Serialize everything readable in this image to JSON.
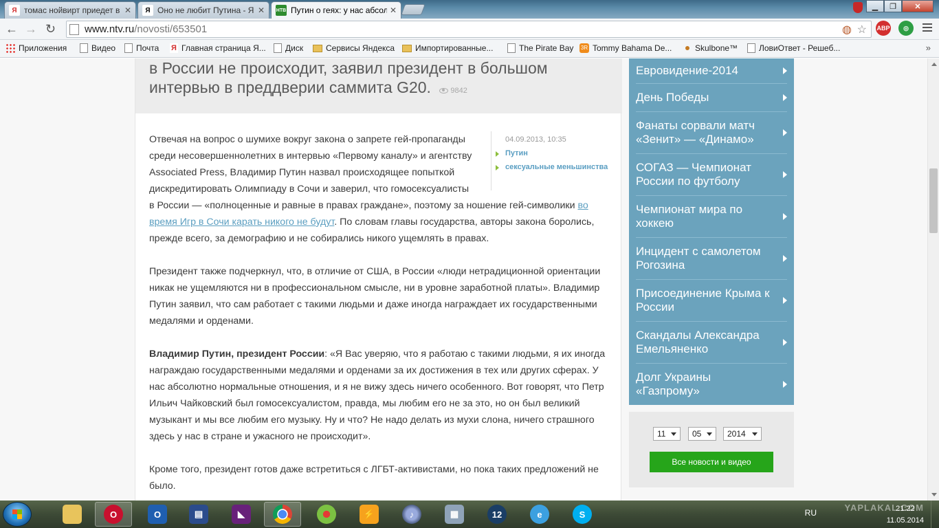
{
  "browser": {
    "tabs": [
      {
        "title": "томас нойвирт приедет в",
        "favicon": "ya"
      },
      {
        "title": "Оно не любит Путина - Я",
        "favicon": "ya-dark"
      },
      {
        "title": "Путин о геях: у нас абсолю",
        "favicon": "ntv",
        "active": true
      }
    ],
    "url_host": "www.ntv.ru",
    "url_path": "/novosti/653501",
    "bookmarks": [
      {
        "label": "Приложения",
        "icon": "apps-icon"
      },
      {
        "label": "Видео",
        "icon": "page-icon"
      },
      {
        "label": "Почта",
        "icon": "page-icon"
      },
      {
        "label": "Главная страница Я...",
        "icon": "yandex-icon"
      },
      {
        "label": "Диск",
        "icon": "page-icon"
      },
      {
        "label": "Сервисы Яндекса",
        "icon": "folder-icon"
      },
      {
        "label": "Импортированные...",
        "icon": "folder-icon"
      },
      {
        "label": "The Pirate Bay",
        "icon": "page-icon"
      },
      {
        "label": "Tommy Bahama De...",
        "icon": "sm-icon"
      },
      {
        "label": "Skulbone™",
        "icon": "dot-icon"
      },
      {
        "label": "ЛовиОтвет - Решеб...",
        "icon": "page-icon"
      }
    ],
    "bookmarks_more": "»",
    "ext_abp": "ABP"
  },
  "article": {
    "headline": "в России не происходит, заявил президент в большом интервью в преддверии саммита G20.",
    "views": "9842",
    "date": "04.09.2013, 10:35",
    "tags": [
      "Путин",
      "сексуальные меньшинства"
    ],
    "p1_a": "Отвечая на вопрос о шумихе вокруг закона о запрете гей-пропаганды среди несовершеннолетних в интервью «Первому каналу» и агентству Associated Press, Владимир Путин назвал происходящее попыткой дискредитировать Олимпиаду в Сочи и заверил, что гомосексуалисты",
    "p1_b": "в России — «полноценные и равные в правах граждане», поэтому за ношение гей-символики ",
    "p1_link": "во время Игр в Сочи карать никого не будут",
    "p1_c": ". По словам главы государства, авторы закона боролись, прежде всего, за демографию и не собирались никого ущемлять в правах.",
    "p2": "Президент также подчеркнул, что, в отличие от США, в России «люди нетрадиционной ориентации никак не ущемляются ни в профессиональном смысле, ни в уровне заработной платы». Владимир Путин заявил, что сам работает с такими людьми и даже иногда награждает их государственными медалями и орденами.",
    "p3_bold": "Владимир Путин, президент России",
    "p3": ": «Я Вас уверяю, что я работаю с такими людьми, я их иногда награждаю государственными медалями и орденами за их достижения в тех или других сферах. У нас абсолютно нормальные отношения, и я не вижу здесь ничего особенного. Вот говорят, что Петр Ильич Чайковский был гомосексуалистом, правда, мы любим его не за это, но он был великий музыкант и мы все любим его музыку. Ну и что? Не надо делать из мухи слона, ничего страшного здесь у нас в стране и ужасного не происходит».",
    "p4": "Кроме того, президент готов даже встретиться с ЛГБТ-активистами, но пока таких предложений не было."
  },
  "sidebar": {
    "items": [
      "Евровидение-2014",
      "День Победы",
      "Фанаты сорвали матч «Зенит» — «Динамо»",
      "СОГАЗ — Чемпионат России по футболу",
      "Чемпионат мира по хоккею",
      "Инцидент с самолетом Рогозина",
      "Присоединение Крыма к России",
      "Скандалы Александра Емельяненко",
      "Долг Украины «Газпрому»"
    ],
    "day": "11",
    "month": "05",
    "year": "2014",
    "all_news": "Все новости и видео"
  },
  "taskbar": {
    "lang": "RU",
    "time": "21:22",
    "date": "11.05.2014",
    "watermark": "YAPLAKAL.COM"
  },
  "colors": {
    "sidebar_bg": "#6ba3bd",
    "button_green": "#26a51a",
    "link": "#5b9ec0"
  }
}
